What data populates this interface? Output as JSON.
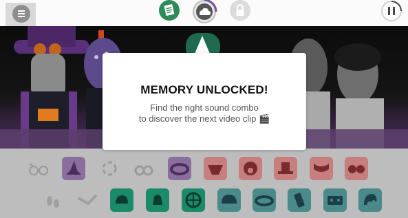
{
  "modal": {
    "title": "MEMORY UNLOCKED!",
    "line1": "Find the right sound combo",
    "line2": "to discover the next video clip 🎬"
  },
  "icons": {
    "menu": "hamburger-menu-icon",
    "notes": "notes-icon",
    "weather": "cloud-weather-icon",
    "lock": "padlock-icon",
    "pause": "pause-icon"
  },
  "colors": {
    "purple_slot": "#8b6d9e",
    "red_slot": "#c77e7e",
    "green_slot": "#1b8a6a",
    "teal_slot": "#4a8a8a",
    "stage_bg": "#111111",
    "tray_bg": "#bdbdbd"
  }
}
